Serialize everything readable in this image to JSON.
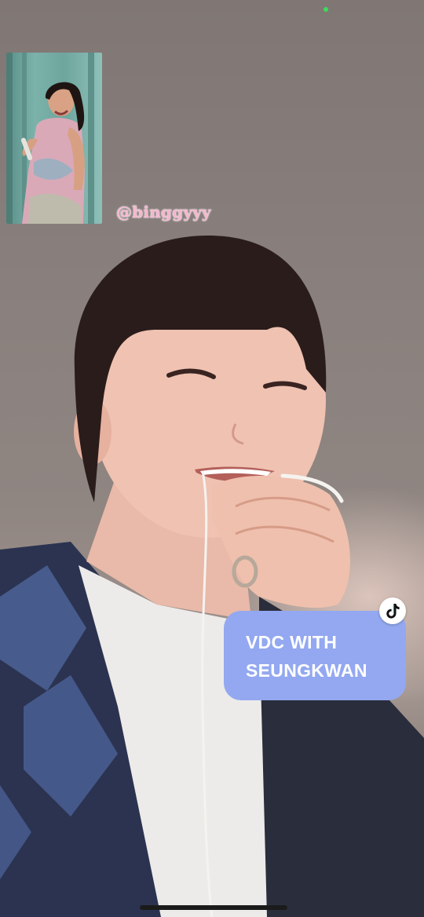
{
  "pip": {
    "username": "@binggyyy"
  },
  "caption": {
    "line1": "VDC WITH",
    "line2": "SEUNGKWAN"
  },
  "icons": {
    "platform": "tiktok-icon",
    "status": "camera-active-dot"
  },
  "colors": {
    "caption_bg": "#93a8f0",
    "caption_text": "#ffffff",
    "username_text": "#f6b6cf",
    "status_dot": "#3ddc5b"
  }
}
